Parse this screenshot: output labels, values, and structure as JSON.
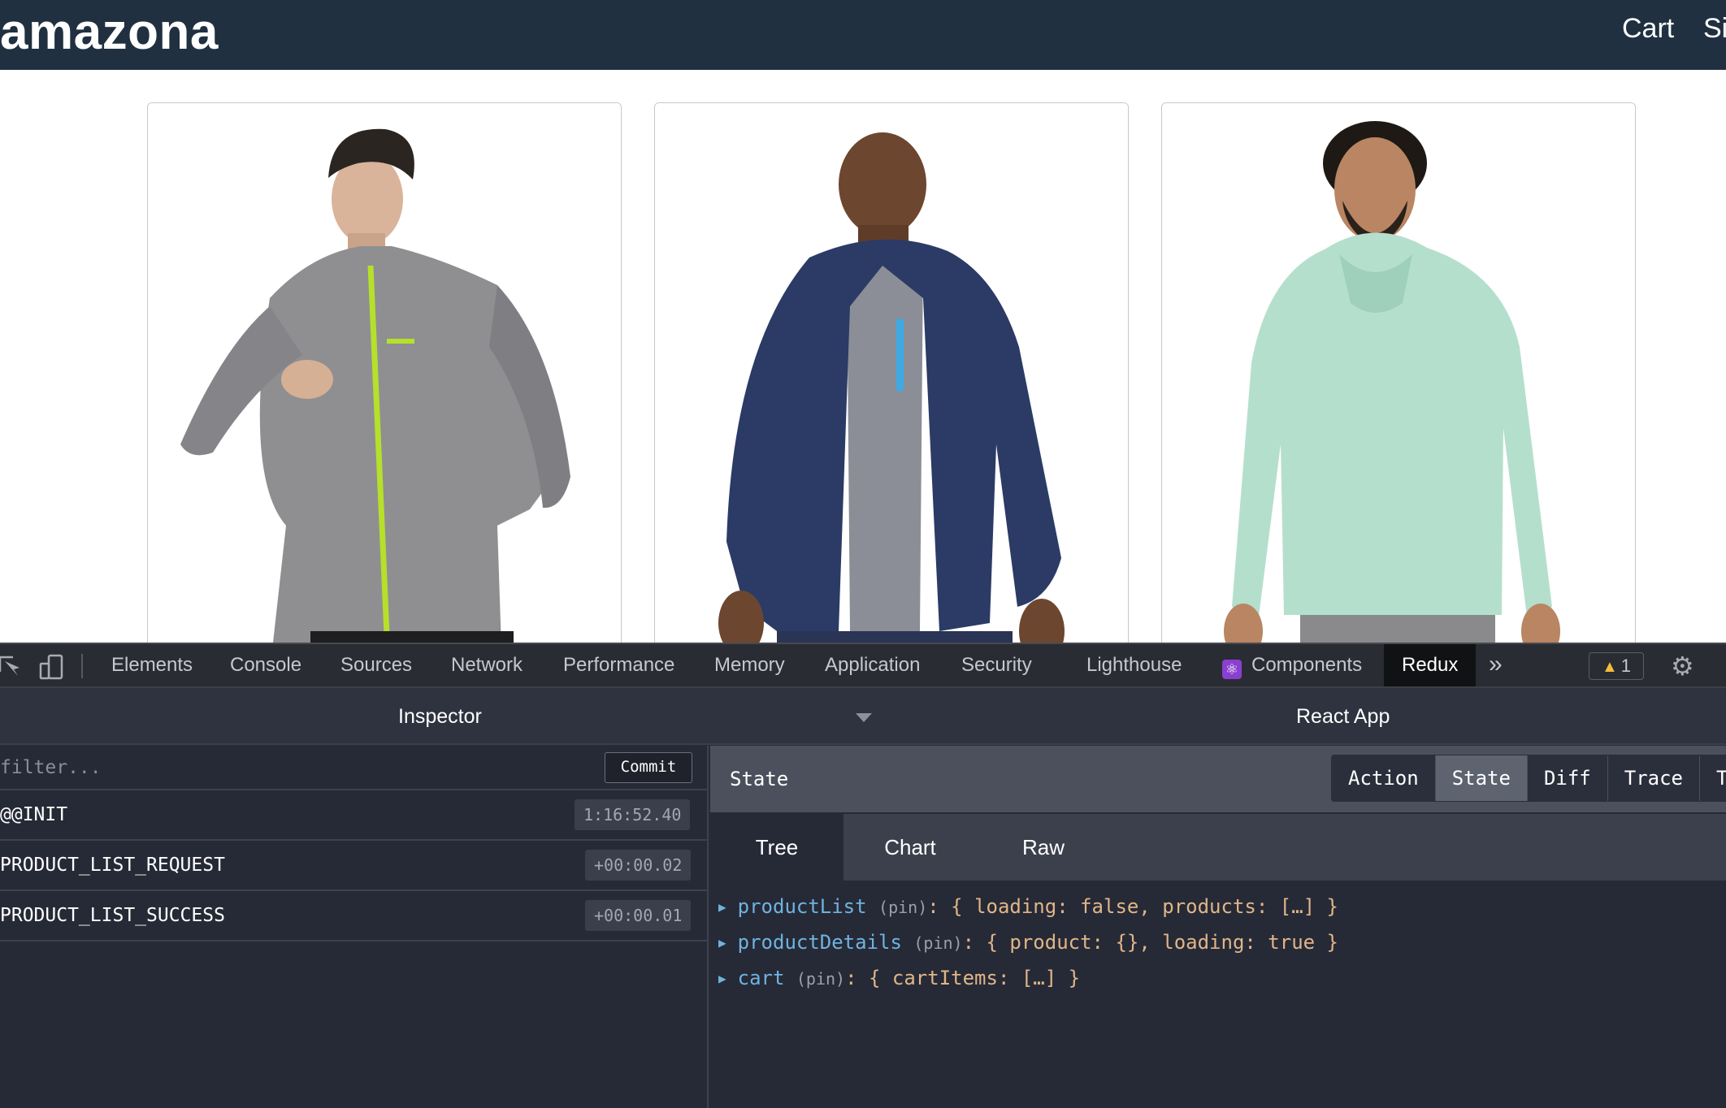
{
  "site": {
    "brand": "amazona",
    "nav": {
      "cart": "Cart",
      "signin": "Si"
    }
  },
  "products": [
    {
      "alt": "grey zip jacket",
      "shirt": "#8f8f92",
      "accent": "#b6e02a"
    },
    {
      "alt": "navy hoodie",
      "shirt": "#2b3b66",
      "accent": "#3fa9e4"
    },
    {
      "alt": "mint hoodie",
      "shirt": "#b5dfcd",
      "accent": "#9ed0bb"
    }
  ],
  "devtools": {
    "tabs": [
      "Elements",
      "Console",
      "Sources",
      "Network",
      "Performance",
      "Memory",
      "Application",
      "Security",
      "Lighthouse",
      "Components",
      "Redux"
    ],
    "active_tab": "Redux",
    "more": "»",
    "warnings": "1"
  },
  "redux": {
    "inspector_title": "Inspector",
    "app_name": "React App",
    "filter_placeholder": "filter...",
    "commit_label": "Commit",
    "actions": [
      {
        "name": "@@INIT",
        "time": "1:16:52.40"
      },
      {
        "name": "PRODUCT_LIST_REQUEST",
        "time": "+00:00.02"
      },
      {
        "name": "PRODUCT_LIST_SUCCESS",
        "time": "+00:00.01"
      }
    ],
    "state_title": "State",
    "modes": [
      "Action",
      "State",
      "Diff",
      "Trace",
      "T"
    ],
    "active_mode": "State",
    "subtabs": [
      "Tree",
      "Chart",
      "Raw"
    ],
    "active_subtab": "Tree",
    "tree": [
      {
        "key": "productList",
        "pin": "(pin)",
        "value": ": { loading: false, products: […] }"
      },
      {
        "key": "productDetails",
        "pin": "(pin)",
        "value": ": { product: {}, loading: true }"
      },
      {
        "key": "cart",
        "pin": "(pin)",
        "value": ": { cartItems: […] }"
      }
    ]
  }
}
